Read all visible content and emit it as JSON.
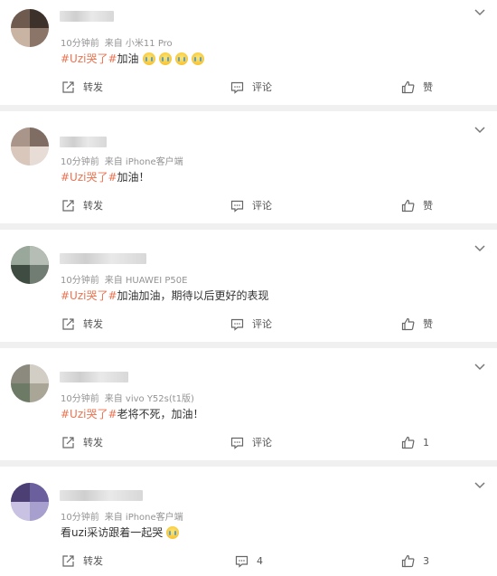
{
  "posts": [
    {
      "time": "10分钟前",
      "source": "来自 小米11 Pro",
      "hashtag": "#Uzi哭了#",
      "text": "加油",
      "emoji_count": 4,
      "emoji_icon": "crying-emoji-icon",
      "repost": "转发",
      "comment": "评论",
      "like": "赞"
    },
    {
      "time": "10分钟前",
      "source": "来自 iPhone客户端",
      "hashtag": "#Uzi哭了#",
      "text": "加油！",
      "repost": "转发",
      "comment": "评论",
      "like": "赞"
    },
    {
      "time": "10分钟前",
      "source": "来自 HUAWEI P50E",
      "hashtag": "#Uzi哭了#",
      "text": "加油加油，期待以后更好的表现",
      "repost": "转发",
      "comment": "评论",
      "like": "赞"
    },
    {
      "time": "10分钟前",
      "source": "来自 vivo Y52s(t1版)",
      "hashtag": "#Uzi哭了#",
      "text": "老将不死，加油！",
      "repost": "转发",
      "comment": "评论",
      "like": "1"
    },
    {
      "time": "10分钟前",
      "source": "来自 iPhone客户端",
      "hashtag": "",
      "text": "看uzi采访跟着一起哭",
      "emoji_count": 1,
      "emoji_icon": "crying-emoji-icon",
      "repost": "转发",
      "comment": "4",
      "like": "3"
    }
  ],
  "colors": {
    "hashtag": "#eb7350",
    "meta": "#939393",
    "background": "#f0f0f0"
  }
}
